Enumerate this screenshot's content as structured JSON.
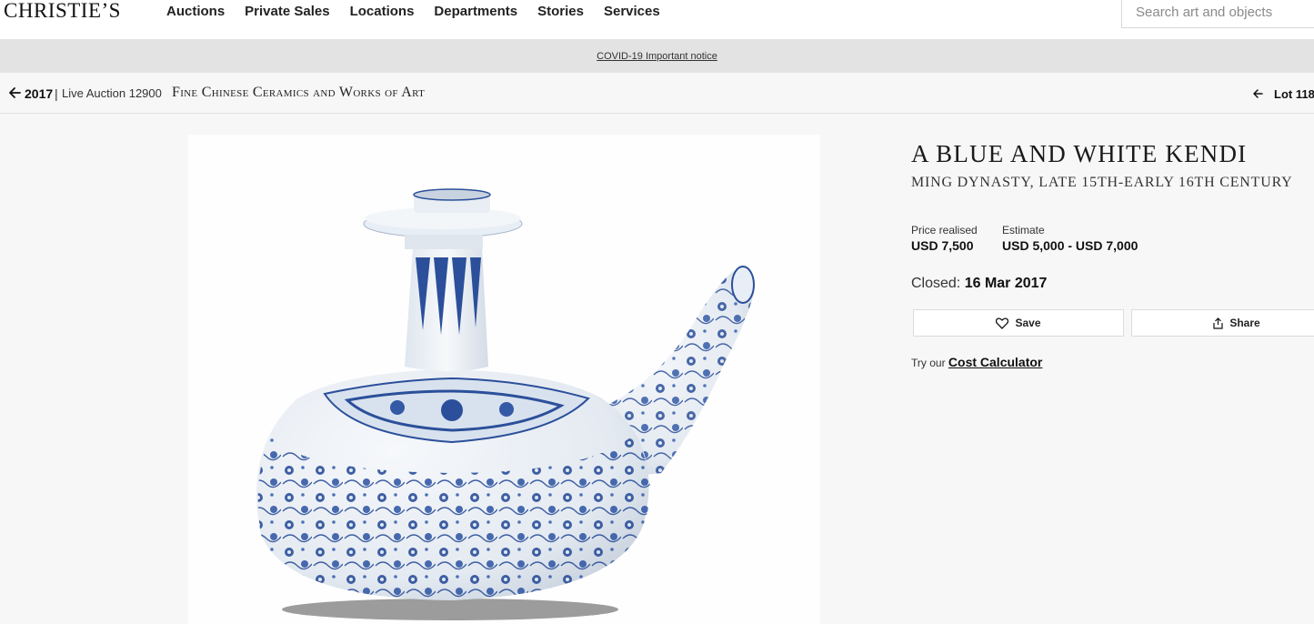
{
  "header": {
    "logo": "CHRISTIE’S",
    "nav": [
      "Auctions",
      "Private Sales",
      "Locations",
      "Departments",
      "Stories",
      "Services"
    ],
    "search_placeholder": "Search art and objects"
  },
  "notice": {
    "link": "COVID-19 Important notice"
  },
  "breadcrumb": {
    "year": "2017",
    "separator": "|",
    "auction": "Live Auction 12900",
    "sale": "Fine Chinese Ceramics and Works of Art",
    "lot": "Lot 118"
  },
  "lot": {
    "title": "A BLUE AND WHITE KENDI",
    "subtitle": "MING DYNASTY, LATE 15TH-EARLY 16TH CENTURY",
    "price_label": "Price realised",
    "price_value": "USD 7,500",
    "estimate_label": "Estimate",
    "estimate_value": "USD 5,000 - USD 7,000",
    "closed_label": "Closed:",
    "closed_date": "16 Mar 2017",
    "save_label": "Save",
    "share_label": "Share",
    "cost_prefix": "Try our",
    "cost_link": "Cost Calculator"
  },
  "colors": {
    "blue_glaze": "#2b4f9a",
    "porcelain": "#eef2f6",
    "notice_bg": "#e3e3e3"
  }
}
